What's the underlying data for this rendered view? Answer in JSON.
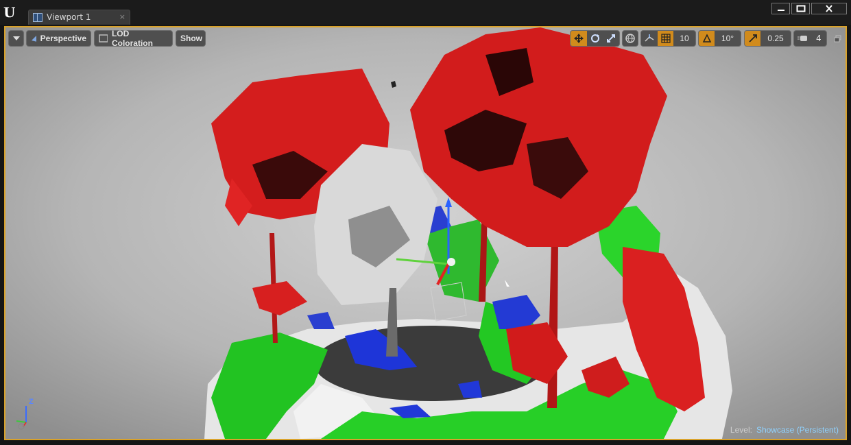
{
  "window": {
    "logo": "U",
    "tab": {
      "icon": "viewport-grid-icon",
      "label": "Viewport 1",
      "close": "×"
    },
    "controls": {
      "minimize": "minimize-icon",
      "maximize": "maximize-icon",
      "close": "close-icon"
    }
  },
  "toolbar": {
    "menu_icon": "chevron-down-icon",
    "view_mode": "Perspective",
    "view_mode_icon": "perspective-icon",
    "lod_label": "LOD Coloration",
    "lod_icon": "lod-icon",
    "show_label": "Show",
    "transform_tools": [
      "translate-icon",
      "rotate-icon",
      "scale-icon"
    ],
    "world_local_icon": "globe-icon",
    "surface_snap_icon": "surface-snap-icon",
    "grid_snap": {
      "icon": "grid-icon",
      "value": "10",
      "active": true
    },
    "rotation_snap": {
      "icon": "angle-icon",
      "value": "10°",
      "active": true
    },
    "scale_snap": {
      "icon": "scale-snap-icon",
      "value": "0.25",
      "active": true
    },
    "camera_speed": {
      "icon": "camera-speed-icon",
      "value": "4"
    },
    "maximize_viewport_icon": "restore-viewport-icon"
  },
  "viewport": {
    "axis_labels": {
      "z": "Z"
    },
    "level_prefix": "Level:",
    "level_name": "Showcase (Persistent)"
  },
  "colors": {
    "accent": "#d9a22a",
    "lod0": "#e81e1e",
    "lod1": "#22d322",
    "lod2": "#1f3be0",
    "lod3": "#f0f0f0",
    "background": "#b9b9b9"
  }
}
